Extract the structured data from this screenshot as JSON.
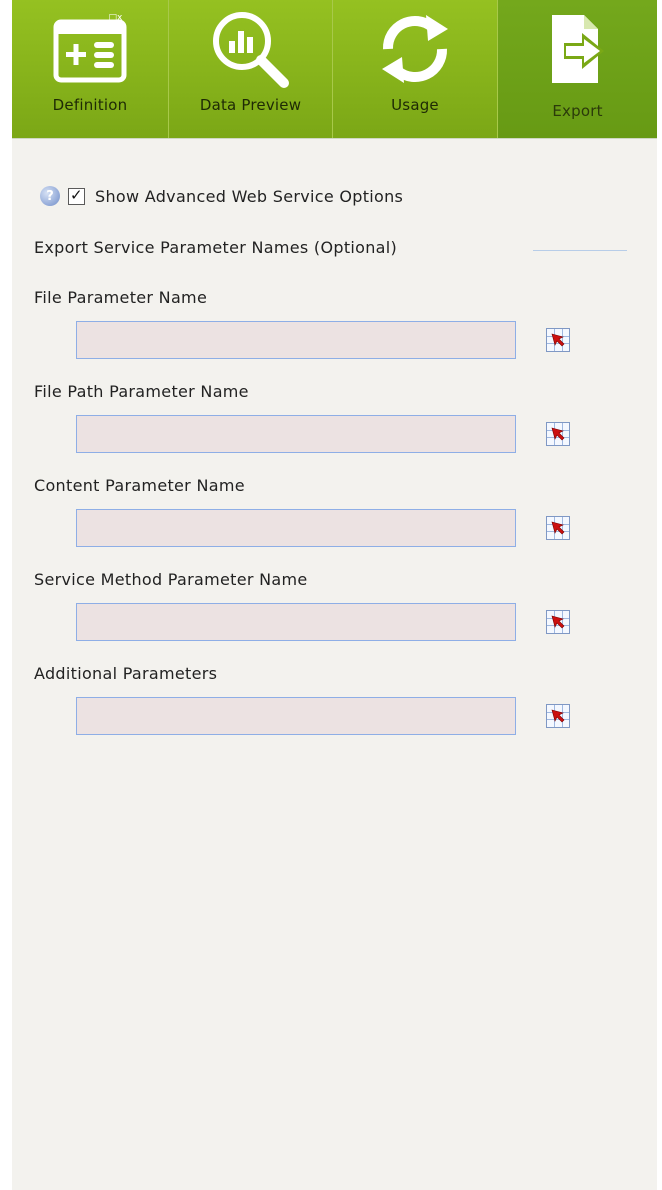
{
  "tabs": [
    {
      "label": "Definition",
      "icon": "definition-window-icon",
      "active": false
    },
    {
      "label": "Data Preview",
      "icon": "data-preview-magnifier-icon",
      "active": false
    },
    {
      "label": "Usage",
      "icon": "usage-refresh-icon",
      "active": false
    },
    {
      "label": "Export",
      "icon": "export-document-arrow-icon",
      "active": true
    }
  ],
  "advanced": {
    "checked": true,
    "label": "Show Advanced Web Service Options"
  },
  "section_title": "Export Service Parameter Names (Optional)",
  "fields": [
    {
      "label": "File Parameter Name",
      "value": ""
    },
    {
      "label": "File Path Parameter Name",
      "value": ""
    },
    {
      "label": "Content Parameter Name",
      "value": ""
    },
    {
      "label": "Service Method Parameter Name",
      "value": ""
    },
    {
      "label": "Additional Parameters",
      "value": ""
    }
  ],
  "colors": {
    "toolbar_green": "#8fbc1e",
    "active_tab_green": "#74a81c",
    "panel_bg": "#f3f2ee",
    "input_bg": "#ece2e2",
    "input_border": "#8eaee6"
  }
}
